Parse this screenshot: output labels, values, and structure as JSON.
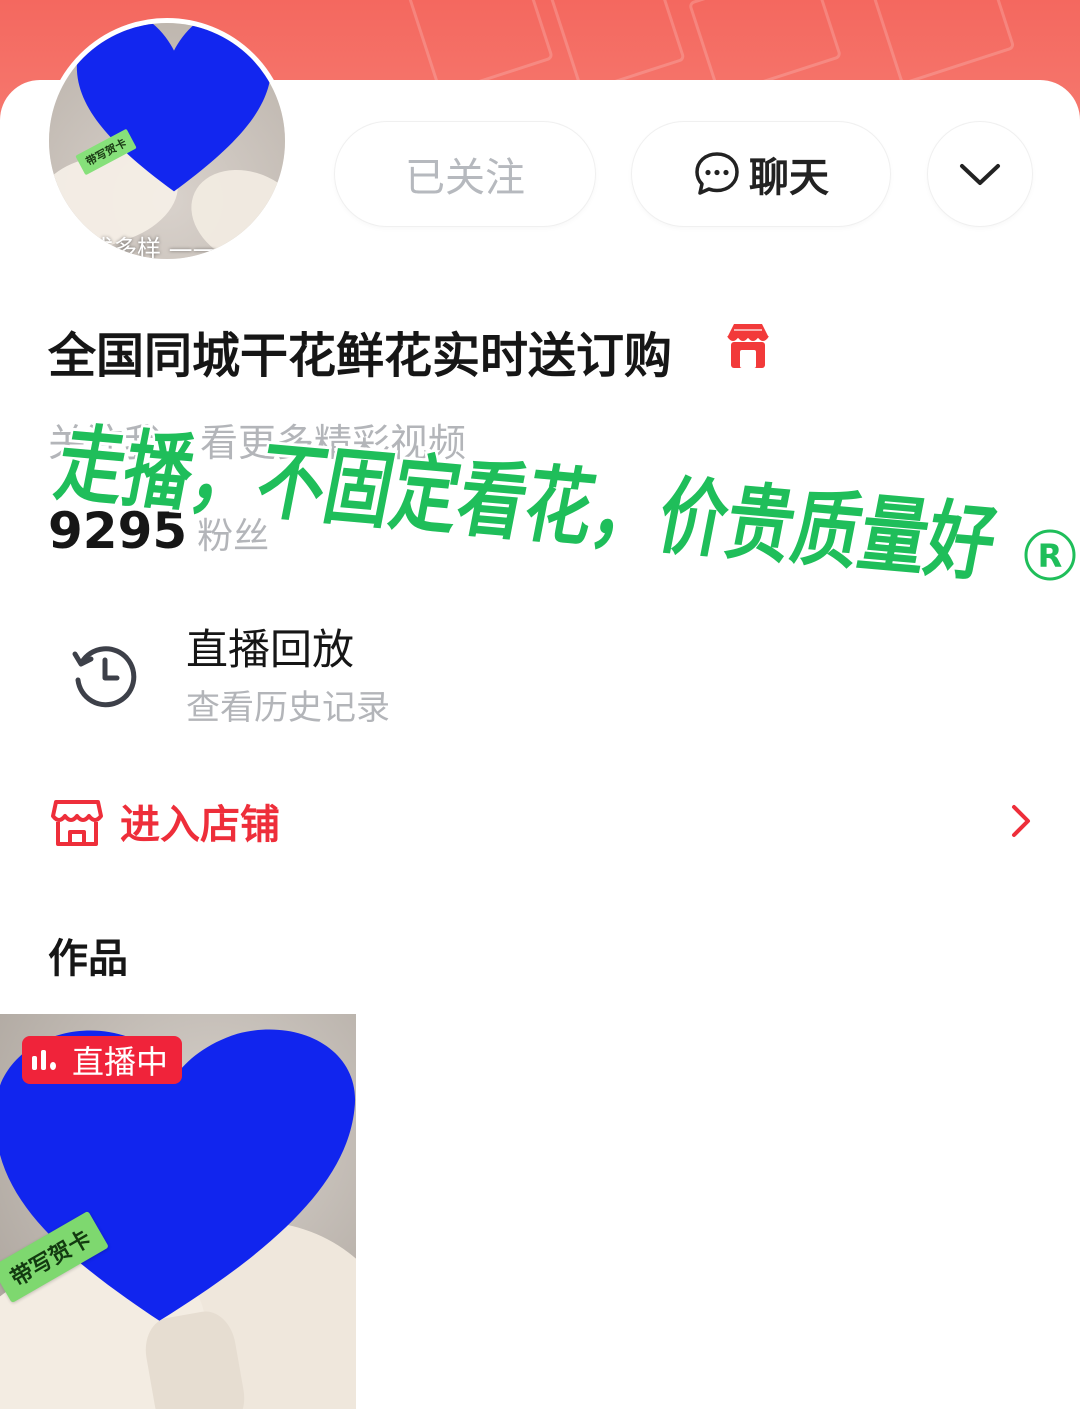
{
  "header": {
    "banner_color": "#f4685f",
    "follow_label": "已关注",
    "chat_label": "聊天",
    "more_icon": "chevron-down-icon"
  },
  "avatar": {
    "card_text": "带写贺卡",
    "caption": "式多样 ——"
  },
  "profile": {
    "name": "全国同城干花鲜花实时送订购",
    "shop_badge_icon": "shop-badge-icon",
    "subtitle": "关注我，看更多精彩视频",
    "fans_count": "9295",
    "fans_label": "粉丝"
  },
  "overlay": {
    "text": "走播，不固定看花，价贵质量好",
    "mark": "R",
    "color": "#1db954"
  },
  "replay": {
    "title": "直播回放",
    "subtitle": "查看历史记录"
  },
  "shop": {
    "label": "进入店铺",
    "color": "#ee2e3a"
  },
  "works": {
    "title": "作品",
    "items": [
      {
        "live_label": "直播中",
        "card_text": "带写贺卡"
      }
    ]
  }
}
